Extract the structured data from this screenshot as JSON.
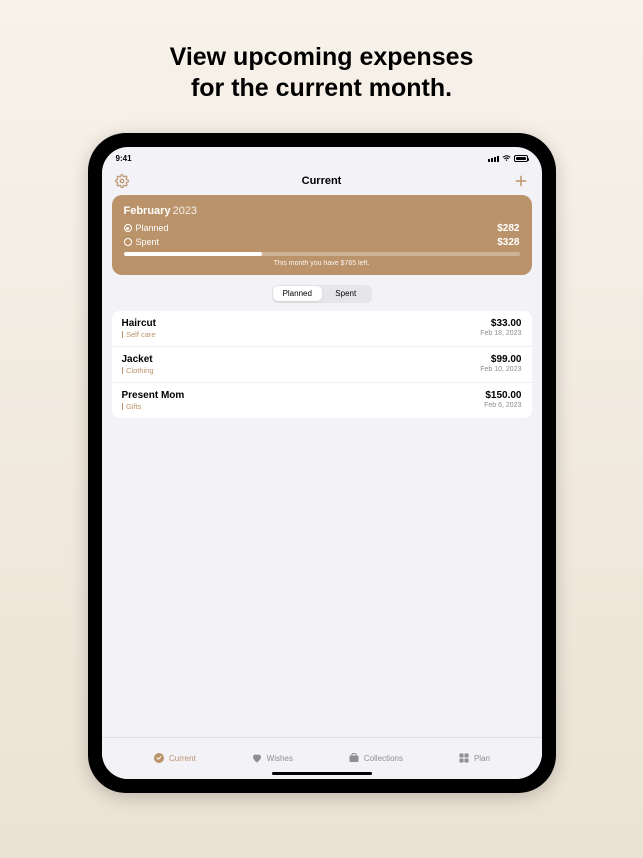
{
  "promo": {
    "line1": "View upcoming expenses",
    "line2": "for the current month."
  },
  "status": {
    "time": "9:41"
  },
  "nav": {
    "title": "Current"
  },
  "summary": {
    "month": "February",
    "year": "2023",
    "planned_label": "Planned",
    "planned_value": "$282",
    "spent_label": "Spent",
    "spent_value": "$328",
    "progress_pct": 35,
    "note": "This month you have $765 left."
  },
  "segmented": {
    "planned": "Planned",
    "spent": "Spent",
    "active": "planned"
  },
  "expenses": [
    {
      "title": "Haircut",
      "category": "Self care",
      "amount": "$33.00",
      "date": "Feb 18, 2023"
    },
    {
      "title": "Jacket",
      "category": "Clothing",
      "amount": "$99.00",
      "date": "Feb 10, 2023"
    },
    {
      "title": "Present Mom",
      "category": "Gifts",
      "amount": "$150.00",
      "date": "Feb 6, 2023"
    }
  ],
  "tabs": {
    "current": "Current",
    "wishes": "Wishes",
    "collections": "Collections",
    "plan": "Plan"
  },
  "colors": {
    "accent": "#bb936a"
  }
}
